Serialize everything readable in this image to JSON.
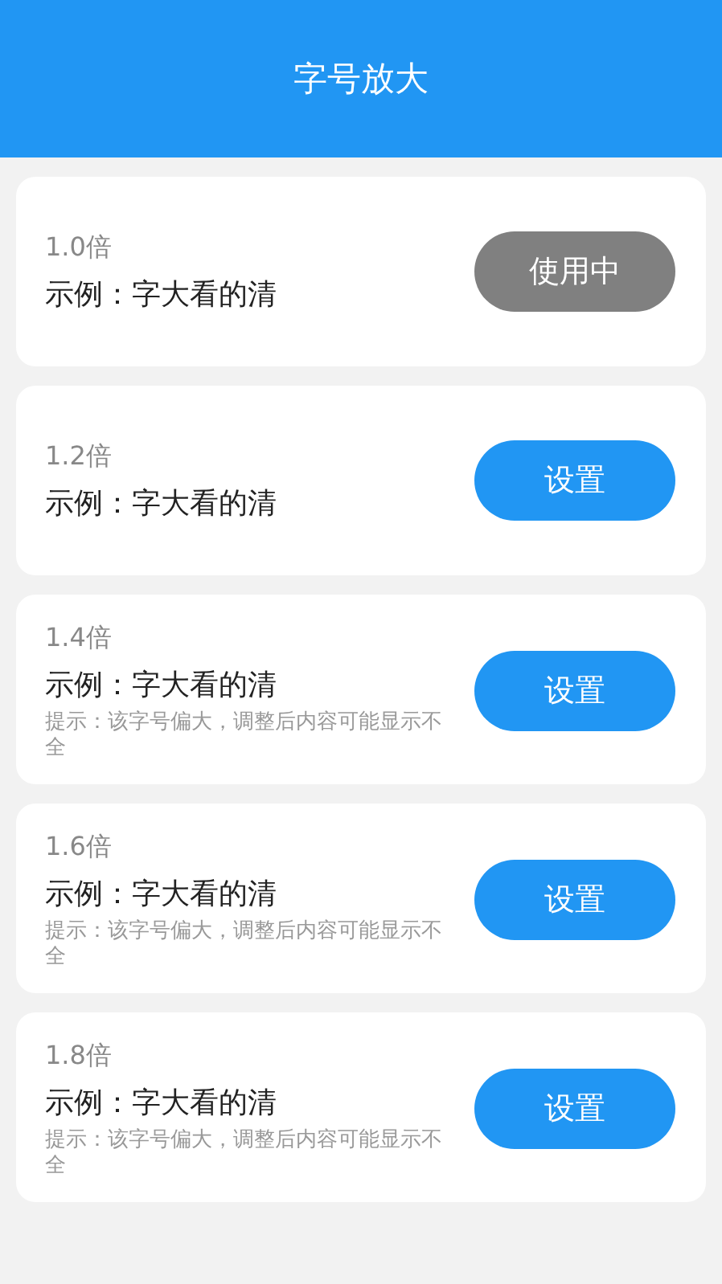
{
  "header": {
    "title": "字号放大"
  },
  "options": [
    {
      "scale": "1.0倍",
      "example": "示例：字大看的清",
      "button": "使用中",
      "selected": true
    },
    {
      "scale": "1.2倍",
      "example": "示例：字大看的清",
      "button": "设置",
      "selected": false
    },
    {
      "scale": "1.4倍",
      "example": "示例：字大看的清",
      "hint": "提示：该字号偏大，调整后内容可能显示不全",
      "button": "设置",
      "selected": false
    },
    {
      "scale": "1.6倍",
      "example": "示例：字大看的清",
      "hint": "提示：该字号偏大，调整后内容可能显示不全",
      "button": "设置",
      "selected": false
    },
    {
      "scale": "1.8倍",
      "example": "示例：字大看的清",
      "hint": "提示：该字号偏大，调整后内容可能显示不全",
      "button": "设置",
      "selected": false
    }
  ]
}
